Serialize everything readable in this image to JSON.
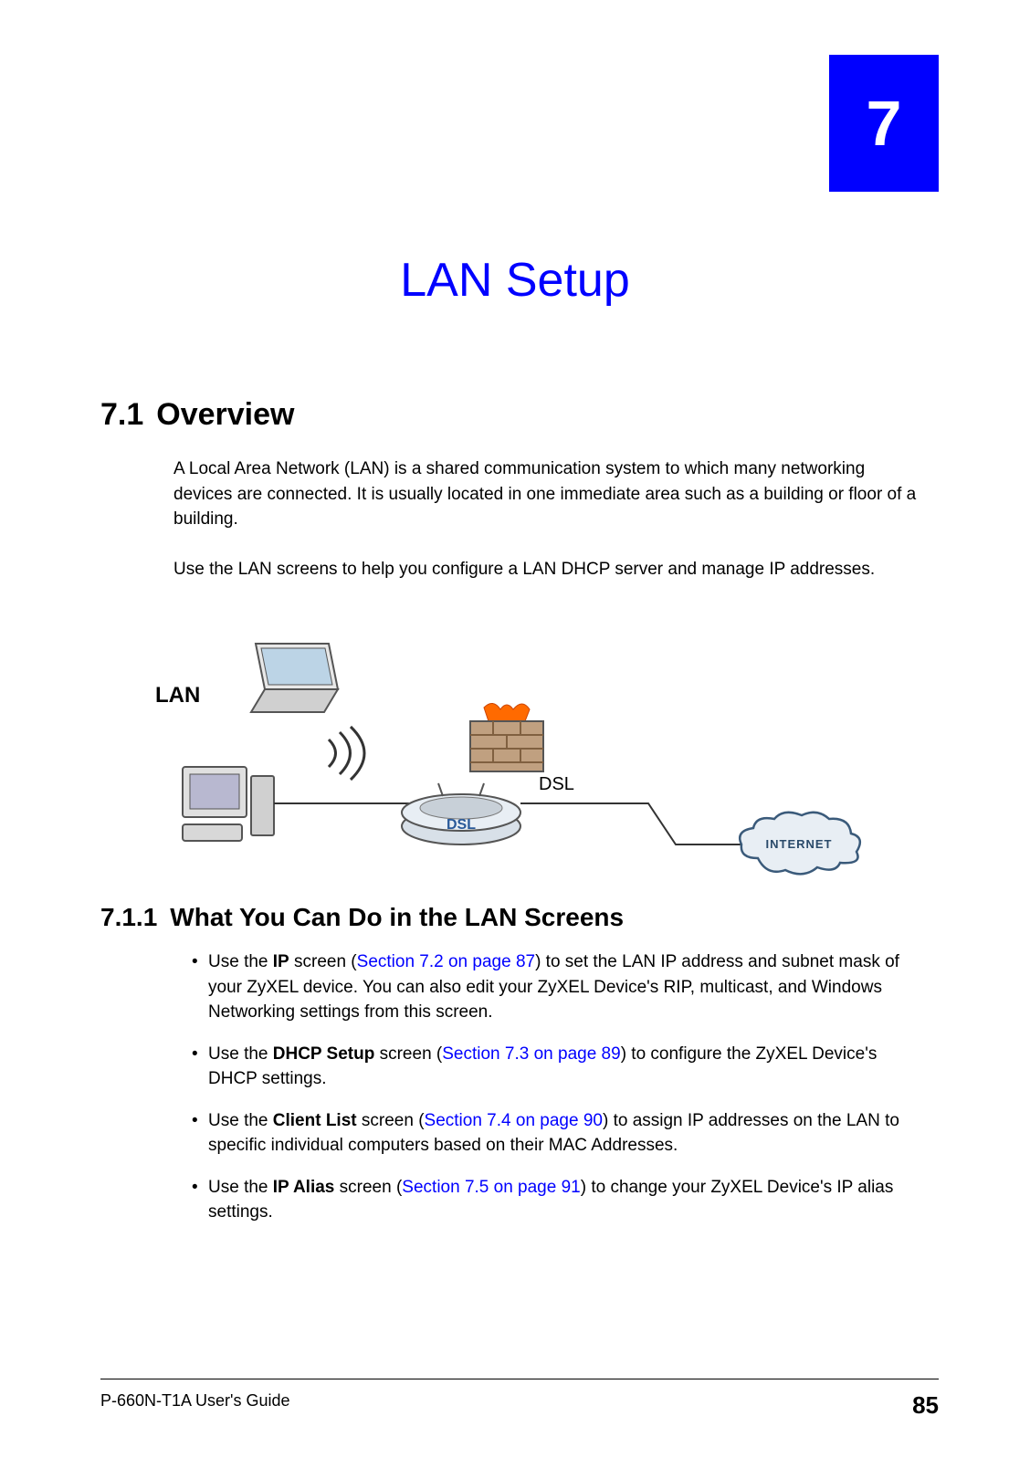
{
  "chapter": {
    "number": "7",
    "title": "LAN Setup"
  },
  "section1": {
    "number": "7.1",
    "title": "Overview",
    "para1": "A Local Area Network (LAN) is a shared communication system to which many networking devices are connected. It is usually located in one immediate area such as a building or floor of a building.",
    "para2": "Use the LAN screens to help you configure a LAN DHCP server and manage IP addresses."
  },
  "diagram": {
    "lan_label": "LAN",
    "dsl_label": "DSL",
    "router_label": "DSL",
    "internet_label": "INTERNET"
  },
  "section11": {
    "number": "7.1.1",
    "title": "What You Can Do in the LAN Screens",
    "bullets": [
      {
        "lead": "Use the ",
        "bold": "IP",
        "mid": " screen (",
        "link": "Section 7.2 on page 87",
        "tail": ") to set the LAN IP address and subnet mask of your ZyXEL device. You can also edit your ZyXEL Device's RIP, multicast, and Windows Networking settings from this screen."
      },
      {
        "lead": "Use the ",
        "bold": "DHCP Setup",
        "mid": " screen (",
        "link": "Section 7.3 on page 89",
        "tail": ") to configure the ZyXEL Device's DHCP settings."
      },
      {
        "lead": "Use the ",
        "bold": "Client List",
        "mid": " screen (",
        "link": "Section 7.4 on page 90",
        "tail": ") to assign IP addresses on the LAN to specific individual computers based on their MAC Addresses."
      },
      {
        "lead": "Use the ",
        "bold": "IP Alias",
        "mid": " screen (",
        "link": "Section 7.5 on page 91",
        "tail": ") to change your ZyXEL Device's IP alias settings."
      }
    ]
  },
  "footer": {
    "guide": "P-660N-T1A User's Guide",
    "page": "85"
  }
}
